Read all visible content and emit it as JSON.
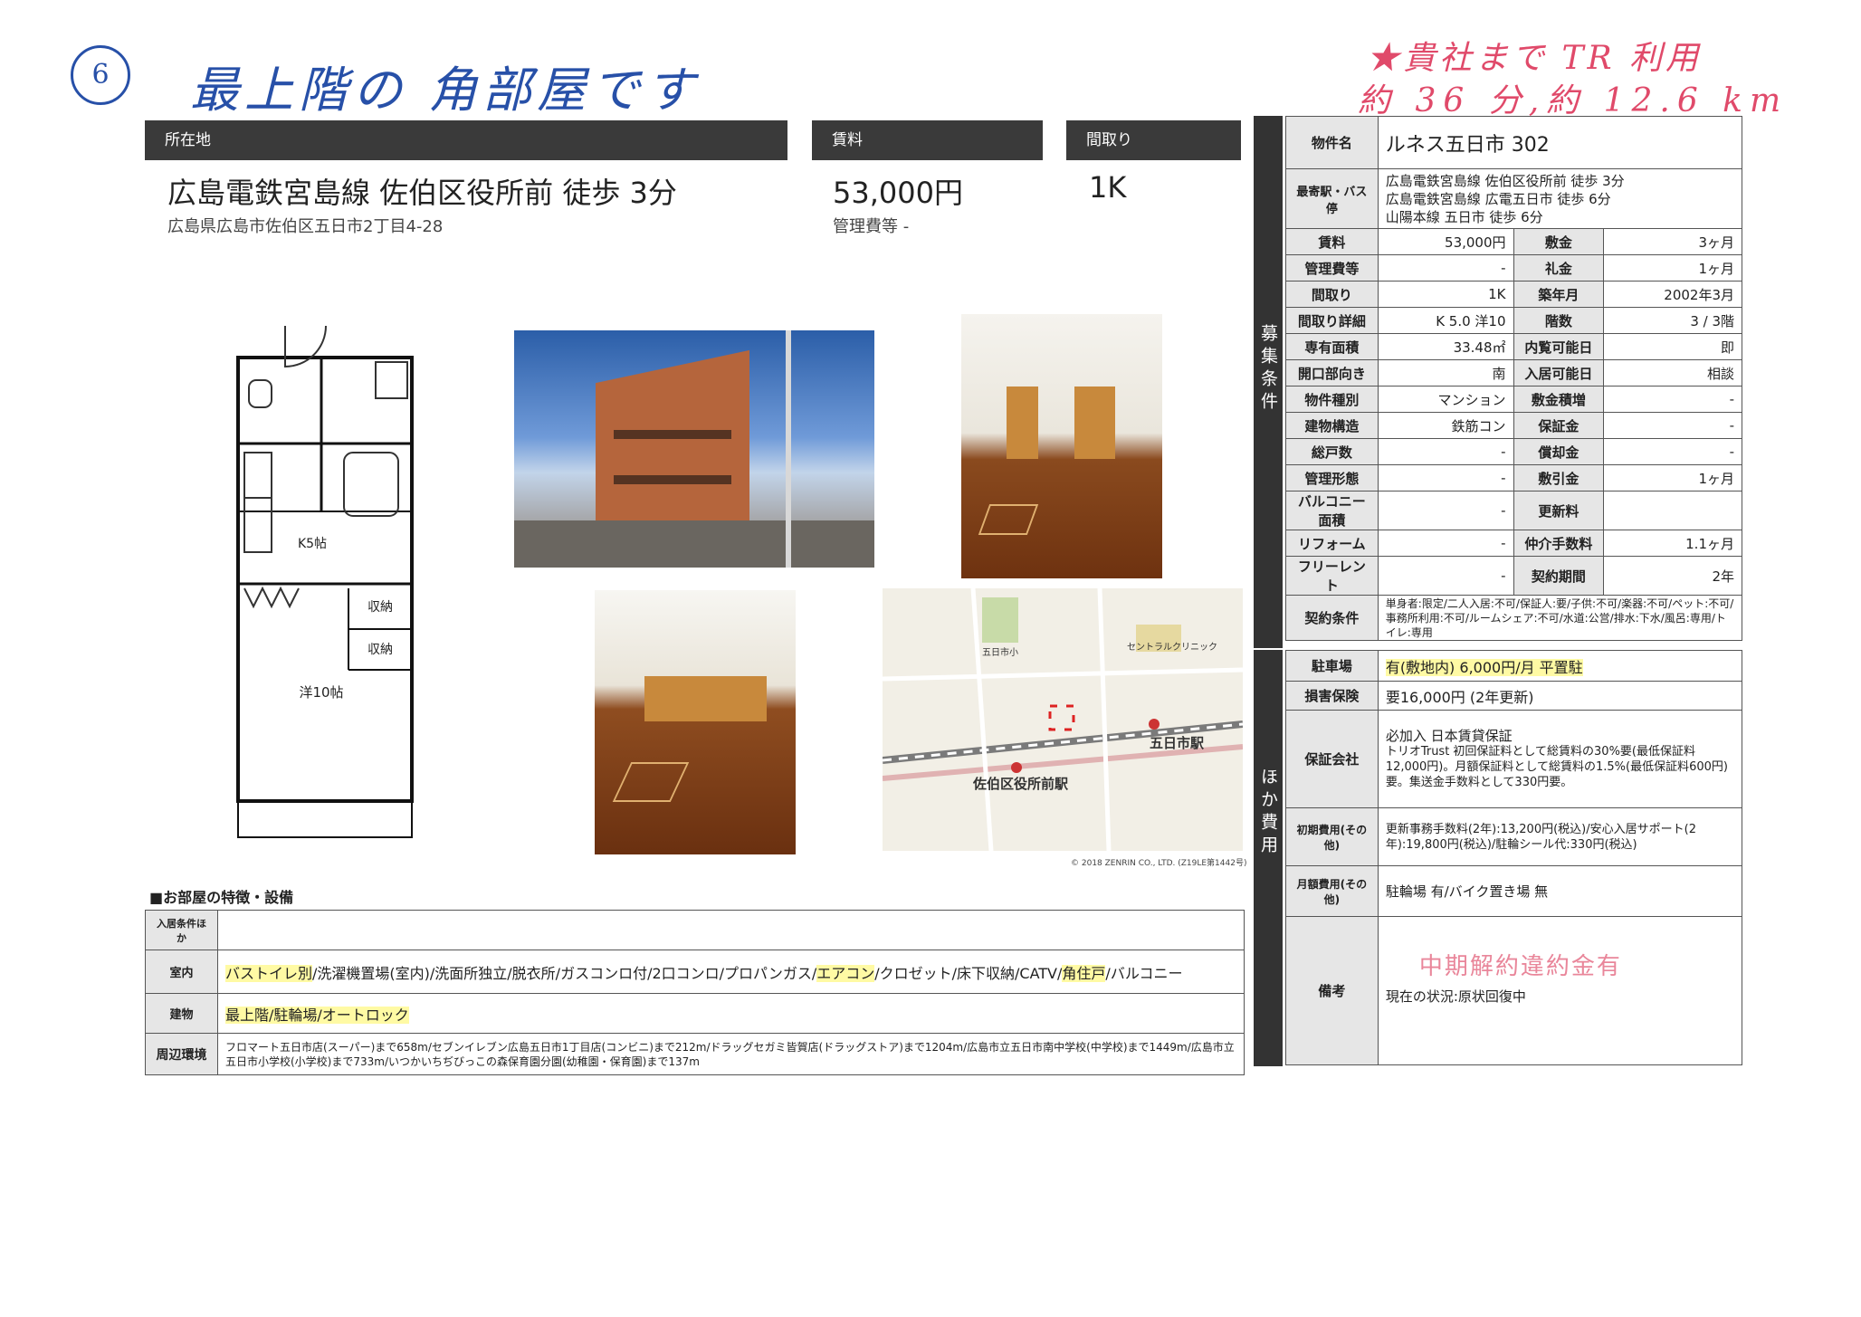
{
  "handwriting": {
    "number": "⑥",
    "note": "最上階の 角部屋です",
    "travel_line1": "★貴社まで TR 利用",
    "travel_line2": "約 36 分,約 12.6 km",
    "stamp": "中期解約違約金有"
  },
  "header": {
    "location_label": "所在地",
    "rent_label": "賃料",
    "layout_label": "間取り",
    "access": "広島電鉄宮島線 佐伯区役所前 徒歩 3分",
    "address": "広島県広島市佐伯区五日市2丁目4-28",
    "rent": "53,000円",
    "mgmt_fee": "管理費等 -",
    "layout": "1K"
  },
  "floorplan": {
    "kitchen": "K5帖",
    "storage1": "収納",
    "storage2": "収納",
    "room": "洋10帖"
  },
  "map": {
    "station1": "五日市駅",
    "station2": "佐伯区役所前駅",
    "label_school": "五日市小",
    "label_clinic": "セントラルクリニック",
    "copyright": "© 2018 ZENRIN CO., LTD. (Z19LE第1442号)"
  },
  "sidebar": {
    "recruit": "募集条件",
    "other": "ほか費用"
  },
  "spec": {
    "property_name_label": "物件名",
    "property_name": "ルネス五日市 302",
    "nearest_label": "最寄駅・バス停",
    "nearest": [
      "広島電鉄宮島線 佐伯区役所前 徒歩 3分",
      "広島電鉄宮島線 広電五日市 徒歩 6分",
      "山陽本線 五日市 徒歩 6分"
    ],
    "rows": [
      {
        "l1": "賃料",
        "v1": "53,000円",
        "l2": "敷金",
        "v2": "3ヶ月"
      },
      {
        "l1": "管理費等",
        "v1": "-",
        "l2": "礼金",
        "v2": "1ヶ月"
      },
      {
        "l1": "間取り",
        "v1": "1K",
        "l2": "築年月",
        "v2": "2002年3月"
      },
      {
        "l1": "間取り詳細",
        "v1": "K 5.0 洋10",
        "l2": "階数",
        "v2": "3 / 3階"
      },
      {
        "l1": "専有面積",
        "v1": "33.48㎡",
        "l2": "内覧可能日",
        "v2": "即"
      },
      {
        "l1": "開口部向き",
        "v1": "南",
        "l2": "入居可能日",
        "v2": "相談"
      },
      {
        "l1": "物件種別",
        "v1": "マンション",
        "l2": "敷金積増",
        "v2": "-"
      },
      {
        "l1": "建物構造",
        "v1": "鉄筋コン",
        "l2": "保証金",
        "v2": "-"
      },
      {
        "l1": "総戸数",
        "v1": "-",
        "l2": "償却金",
        "v2": "-"
      },
      {
        "l1": "管理形態",
        "v1": "-",
        "l2": "敷引金",
        "v2": "1ヶ月"
      },
      {
        "l1": "バルコニー面積",
        "v1": "-",
        "l2": "更新料",
        "v2": ""
      },
      {
        "l1": "リフォーム",
        "v1": "-",
        "l2": "仲介手数料",
        "v2": "1.1ヶ月"
      },
      {
        "l1": "フリーレント",
        "v1": "-",
        "l2": "契約期間",
        "v2": "2年"
      }
    ],
    "contract_label": "契約条件",
    "contract": "単身者:限定/二人入居:不可/保証人:要/子供:不可/楽器:不可/ペット:不可/事務所利用:不可/ルームシェア:不可/水道:公営/排水:下水/風呂:専用/トイレ:専用"
  },
  "costs": {
    "parking_label": "駐車場",
    "parking": "有(敷地内) 6,000円/月 平置駐",
    "insurance_label": "損害保険",
    "insurance": "要16,000円 (2年更新)",
    "guarantor_label": "保証会社",
    "guarantor_line1": "必加入 日本賃貸保証",
    "guarantor_text": "トリオTrust 初回保証料として総賃料の30%要(最低保証料12,000円)。月額保証料として総賃料の1.5%(最低保証料600円)要。集送金手数料として330円要。",
    "initial_label": "初期費用(その他)",
    "initial": "更新事務手数料(2年):13,200円(税込)/安心入居サポート(2年):19,800円(税込)/駐輪シール代:330円(税込)",
    "monthly_label": "月額費用(その他)",
    "monthly": "駐輪場 有/バイク置き場 無",
    "remarks_label": "備考",
    "remarks": "現在の状況:原状回復中"
  },
  "features": {
    "title": "■お部屋の特徴・設備",
    "cond_label": "入居条件ほか",
    "cond": "",
    "room_label": "室内",
    "room_hl1": "バストイレ別",
    "room_mid1": "/洗濯機置場(室内)/洗面所独立/脱衣所/ガスコンロ付/2口コンロ/プロパンガス/",
    "room_hl2": "エアコン",
    "room_mid2": "/クロゼット/床下収納/CATV/",
    "room_hl3": "角住戸",
    "room_end": "/バルコニー",
    "building_label": "建物",
    "building": "最上階/駐輪場/オートロック",
    "env_label": "周辺環境",
    "env": "フロマート五日市店(スーパー)まで658m/セブンイレブン広島五日市1丁目店(コンビニ)まで212m/ドラッグセガミ皆賀店(ドラッグストア)まで1204m/広島市立五日市南中学校(中学校)まで1449m/広島市立五日市小学校(小学校)まで733m/いつかいちぢびっこの森保育園分園(幼稚園・保育園)まで137m"
  }
}
